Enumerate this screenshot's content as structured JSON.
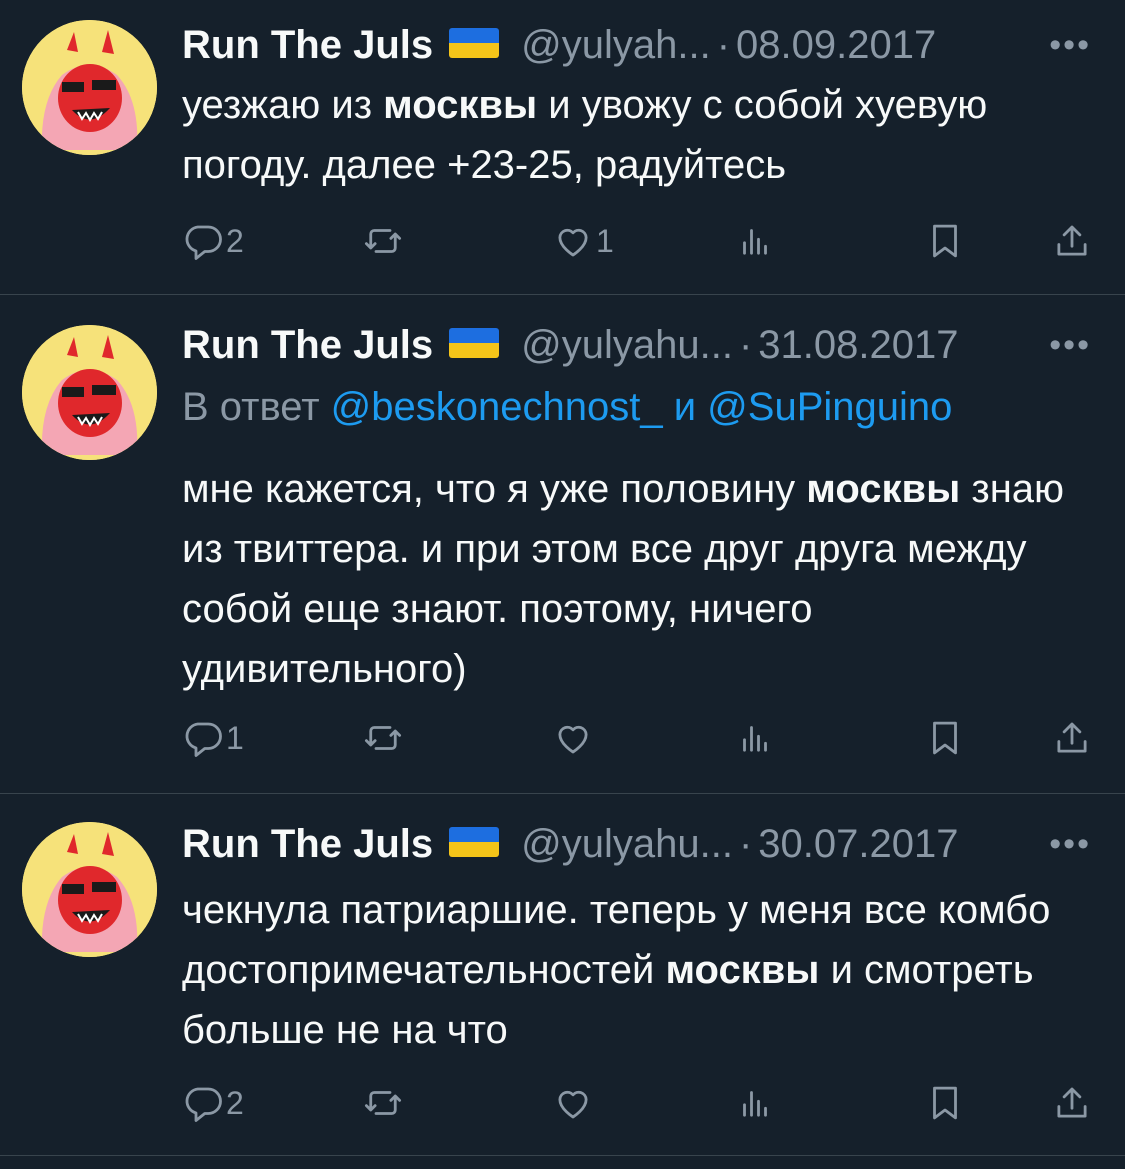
{
  "tweets": [
    {
      "name": "Run The Juls",
      "handle": "@yulyah...",
      "separator": "·",
      "date": "08.09.2017",
      "more": "•••",
      "text_parts": [
        "уезжаю из ",
        "москвы",
        " и увожу с собой хуевую погоду. далее +23-25, радуйтесь"
      ],
      "reply_count": "2",
      "retweet_count": "",
      "like_count": "1"
    },
    {
      "name": "Run The Juls",
      "handle": "@yulyahu...",
      "separator": "·",
      "date": "31.08.2017",
      "more": "•••",
      "reply_to": {
        "prefix": "В ответ ",
        "mention1": "@beskonechnost_",
        "joiner": " и ",
        "mention2": "@SuPinguino"
      },
      "text_parts": [
        "мне кажется, что я уже половину ",
        "москвы",
        " знаю из твиттера. и при этом все друг друга между собой еще знают. поэтому, ничего удивительного)"
      ],
      "reply_count": "1",
      "retweet_count": "",
      "like_count": ""
    },
    {
      "name": "Run The Juls",
      "handle": "@yulyahu...",
      "separator": "·",
      "date": "30.07.2017",
      "more": "•••",
      "text_parts": [
        "чекнула патриаршие. теперь у меня все комбо достопримечательностей ",
        "москвы",
        " и смотреть больше не на что"
      ],
      "reply_count": "2",
      "retweet_count": "",
      "like_count": ""
    }
  ],
  "icons": {
    "reply": "reply-icon",
    "retweet": "retweet-icon",
    "like": "heart-icon",
    "views": "views-icon",
    "bookmark": "bookmark-icon",
    "share": "share-icon",
    "flag": "ukraine-flag-icon"
  },
  "colors": {
    "background": "#15202b",
    "text": "#f7f9f9",
    "muted": "#8b98a5",
    "link": "#1d9bf0",
    "divider": "#38444d"
  }
}
